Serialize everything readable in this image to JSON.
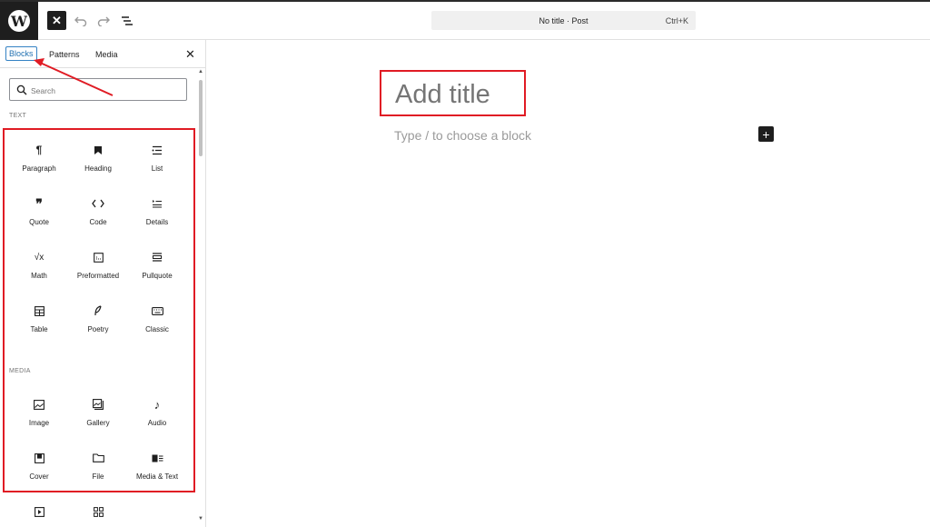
{
  "topbar": {
    "document_title": "No title · Post",
    "shortcut": "Ctrl+K"
  },
  "inserter": {
    "tabs": [
      {
        "label": "Blocks",
        "selected": true
      },
      {
        "label": "Patterns",
        "selected": false
      },
      {
        "label": "Media",
        "selected": false
      }
    ],
    "search_placeholder": "Search",
    "categories": {
      "text": "TEXT",
      "media": "MEDIA"
    },
    "text_blocks": [
      {
        "label": "Paragraph",
        "icon": "paragraph-icon"
      },
      {
        "label": "Heading",
        "icon": "heading-icon"
      },
      {
        "label": "List",
        "icon": "list-icon"
      },
      {
        "label": "Quote",
        "icon": "quote-icon"
      },
      {
        "label": "Code",
        "icon": "code-icon"
      },
      {
        "label": "Details",
        "icon": "details-icon"
      },
      {
        "label": "Math",
        "icon": "math-icon"
      },
      {
        "label": "Preformatted",
        "icon": "preformatted-icon"
      },
      {
        "label": "Pullquote",
        "icon": "pullquote-icon"
      },
      {
        "label": "Table",
        "icon": "table-icon"
      },
      {
        "label": "Poetry",
        "icon": "poetry-icon"
      },
      {
        "label": "Classic",
        "icon": "classic-icon"
      }
    ],
    "media_blocks": [
      {
        "label": "Image",
        "icon": "image-icon"
      },
      {
        "label": "Gallery",
        "icon": "gallery-icon"
      },
      {
        "label": "Audio",
        "icon": "audio-icon"
      },
      {
        "label": "Cover",
        "icon": "cover-icon"
      },
      {
        "label": "File",
        "icon": "file-icon"
      },
      {
        "label": "Media & Text",
        "icon": "media-text-icon"
      }
    ],
    "partial_blocks": [
      {
        "icon": "video-icon"
      },
      {
        "icon": "grid-icon"
      }
    ]
  },
  "canvas": {
    "title_placeholder": "Add title",
    "block_placeholder": "Type / to choose a block"
  },
  "colors": {
    "accent": "#2271b1",
    "annotation": "#e01b24",
    "dark": "#1e1e1e"
  }
}
